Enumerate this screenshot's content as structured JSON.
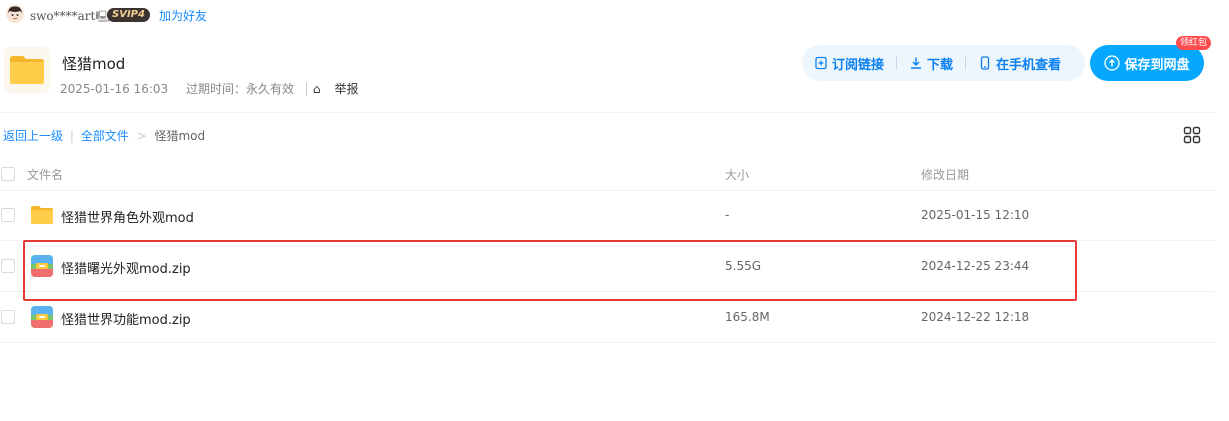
{
  "user": {
    "name": "swo****art",
    "vip_badge": "SVIP4",
    "add_friend": "加为好友"
  },
  "share": {
    "title": "怪猎mod",
    "created": "2025-01-16 16:03",
    "expire_label": "过期时间：永久有效",
    "report": "举报"
  },
  "actions": {
    "subscribe": "订阅链接",
    "download": "下载",
    "phone_view": "在手机查看",
    "save": "保存到网盘",
    "red_packet": "领红包"
  },
  "breadcrumb": {
    "back": "返回上一级",
    "all_files": "全部文件",
    "current": "怪猎mod"
  },
  "table": {
    "headers": {
      "name": "文件名",
      "size": "大小",
      "date": "修改日期"
    },
    "rows": [
      {
        "name": "怪猎世界角色外观mod",
        "size": "-",
        "date": "2025-01-15 12:10",
        "type": "folder"
      },
      {
        "name": "怪猎曙光外观mod.zip",
        "size": "5.55G",
        "date": "2024-12-25 23:44",
        "type": "zip"
      },
      {
        "name": "怪猎世界功能mod.zip",
        "size": "165.8M",
        "date": "2024-12-22 12:18",
        "type": "zip"
      }
    ]
  },
  "colors": {
    "accent": "#06a7ff",
    "link": "#1a8cff",
    "highlight_border": "#e53935"
  }
}
